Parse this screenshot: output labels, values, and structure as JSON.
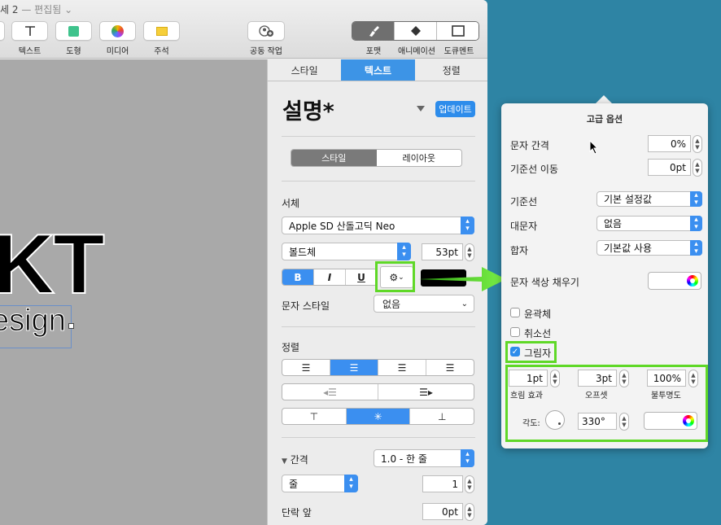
{
  "window": {
    "title": "세 2",
    "title_sep": "—",
    "title_status": "편집됨"
  },
  "toolbar": {
    "text_label": "텍스트",
    "shape_label": "도형",
    "media_label": "미디어",
    "comment_label": "주석",
    "collab_label": "공동 작업",
    "format_label": "포맷",
    "animate_label": "애니메이션",
    "document_label": "도큐멘트"
  },
  "canvas": {
    "big_text": "KT",
    "sub_text": "esign"
  },
  "inspector": {
    "tabs": [
      "스타일",
      "텍스트",
      "정렬"
    ],
    "paragraph_style": "설명*",
    "update_button": "업데이트",
    "style_layout": [
      "스타일",
      "레이아웃"
    ],
    "font_heading": "서체",
    "font_family": "Apple SD 산돌고딕 Neo",
    "font_weight": "볼드체",
    "font_size": "53pt",
    "bold": "B",
    "italic": "I",
    "underline": "U",
    "char_style_label": "문자 스타일",
    "char_style_value": "없음",
    "align_heading": "정렬",
    "spacing_label": "간격",
    "spacing_value": "1.0 - 한 줄",
    "line_unit": "줄",
    "line_value": "1",
    "before_para_label": "단락 앞",
    "before_para_value": "0pt"
  },
  "popover": {
    "title": "고급 옵션",
    "char_spacing_label": "문자 간격",
    "char_spacing_value": "0%",
    "baseline_shift_label": "기준선 이동",
    "baseline_shift_value": "0pt",
    "baseline_label": "기준선",
    "baseline_value": "기본 설정값",
    "caps_label": "대문자",
    "caps_value": "없음",
    "ligature_label": "합자",
    "ligature_value": "기본값 사용",
    "fill_label": "문자 색상 채우기",
    "outline_label": "윤곽체",
    "strike_label": "취소선",
    "shadow_label": "그림자",
    "shadow_checked": true,
    "blur_value": "1pt",
    "blur_label": "흐림 효과",
    "offset_value": "3pt",
    "offset_label": "오프셋",
    "opacity_value": "100%",
    "opacity_label": "불투명도",
    "angle_label": "각도:",
    "angle_value": "330°"
  },
  "colors": {
    "accent": "#3b8ff0",
    "highlight": "#5fd827",
    "desktop": "#2e84a4"
  }
}
